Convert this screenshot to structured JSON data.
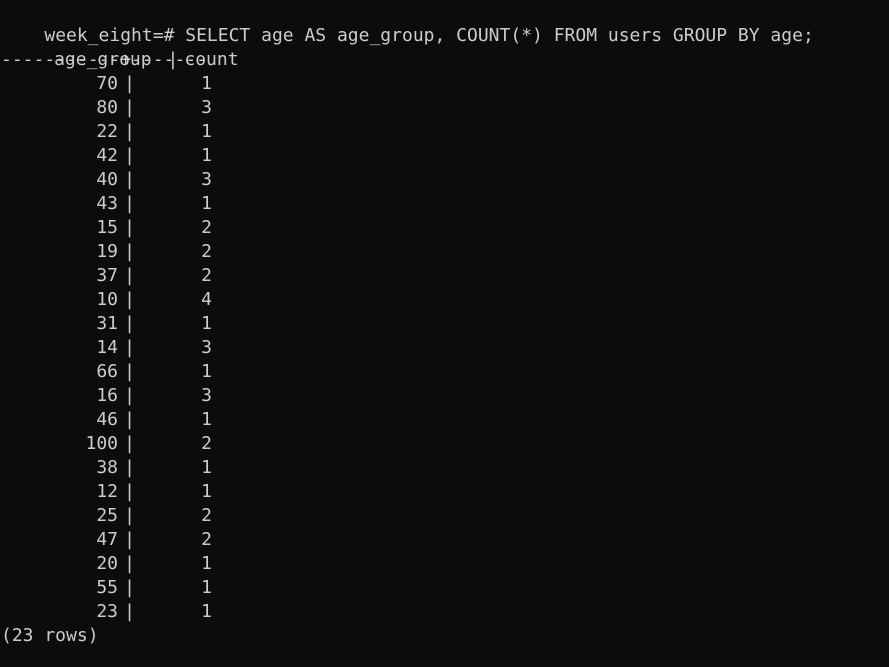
{
  "terminal": {
    "prompt": "week_eight=#",
    "command": " SELECT age AS age_group, COUNT(*) FROM users GROUP BY age;",
    "columns": [
      "age_group",
      "count"
    ],
    "separator": "|",
    "divider": "-----------+-------",
    "rows": [
      {
        "age_group": "70",
        "count": "1"
      },
      {
        "age_group": "80",
        "count": "3"
      },
      {
        "age_group": "22",
        "count": "1"
      },
      {
        "age_group": "42",
        "count": "1"
      },
      {
        "age_group": "40",
        "count": "3"
      },
      {
        "age_group": "43",
        "count": "1"
      },
      {
        "age_group": "15",
        "count": "2"
      },
      {
        "age_group": "19",
        "count": "2"
      },
      {
        "age_group": "37",
        "count": "2"
      },
      {
        "age_group": "10",
        "count": "4"
      },
      {
        "age_group": "31",
        "count": "1"
      },
      {
        "age_group": "14",
        "count": "3"
      },
      {
        "age_group": "66",
        "count": "1"
      },
      {
        "age_group": "16",
        "count": "3"
      },
      {
        "age_group": "46",
        "count": "1"
      },
      {
        "age_group": "100",
        "count": "2"
      },
      {
        "age_group": "38",
        "count": "1"
      },
      {
        "age_group": "12",
        "count": "1"
      },
      {
        "age_group": "25",
        "count": "2"
      },
      {
        "age_group": "47",
        "count": "2"
      },
      {
        "age_group": "20",
        "count": "1"
      },
      {
        "age_group": "55",
        "count": "1"
      },
      {
        "age_group": "23",
        "count": "1"
      }
    ],
    "footer": "(23 rows)"
  }
}
